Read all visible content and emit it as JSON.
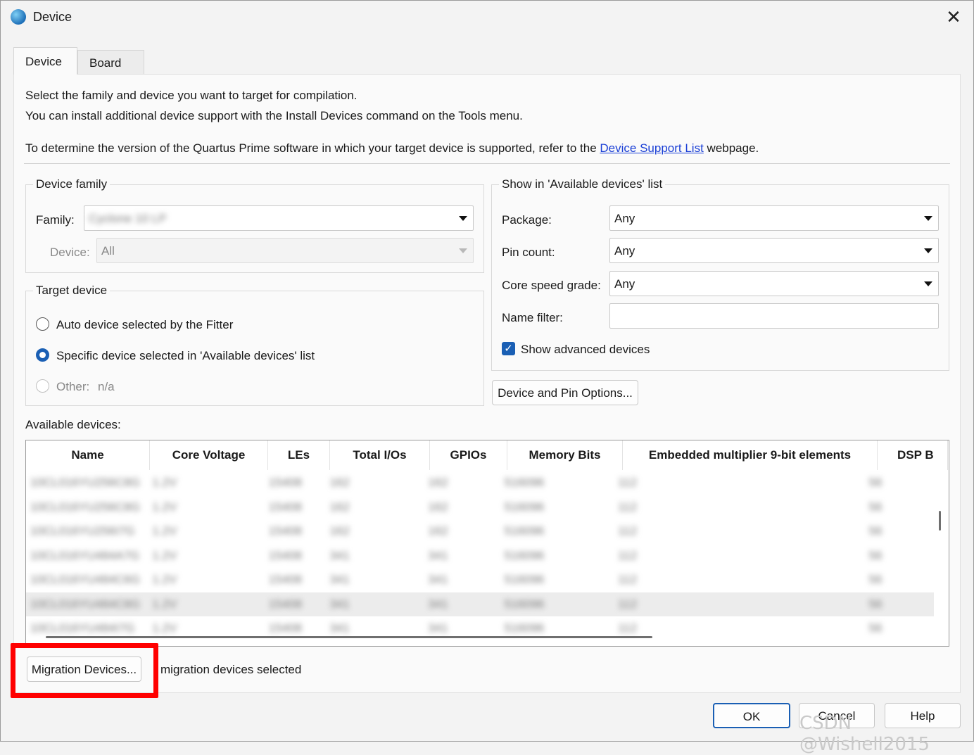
{
  "window": {
    "title": "Device",
    "close_glyph": "✕"
  },
  "tabs": [
    {
      "label": "Device"
    },
    {
      "label": "Board"
    }
  ],
  "intro": {
    "line1": "Select the family and device you want to target for compilation.",
    "line2": "You can install additional device support with the Install Devices command on the Tools menu.",
    "line3_prefix": "To determine the version of the Quartus Prime software in which your target device is supported, refer to the ",
    "line3_link": "Device Support List",
    "line3_suffix": " webpage."
  },
  "device_family": {
    "title": "Device family",
    "family_label": "Family:",
    "family_value": "Cyclone 10 LP",
    "device_label": "Device:",
    "device_value": "All"
  },
  "target_device": {
    "title": "Target device",
    "options": [
      {
        "label": "Auto device selected by the Fitter",
        "checked": false,
        "enabled": true
      },
      {
        "label": "Specific device selected in 'Available devices' list",
        "checked": true,
        "enabled": true
      },
      {
        "label": "Other:",
        "value": "n/a",
        "checked": false,
        "enabled": false
      }
    ]
  },
  "filters": {
    "title": "Show in 'Available devices' list",
    "package_label": "Package:",
    "package_value": "Any",
    "pin_count_label": "Pin count:",
    "pin_count_value": "Any",
    "speed_label": "Core speed grade:",
    "speed_value": "Any",
    "name_filter_label": "Name filter:",
    "name_filter_value": "",
    "advanced_label": "Show advanced devices",
    "advanced_checked": true
  },
  "device_pin_options_label": "Device and Pin Options...",
  "available_devices": {
    "label": "Available devices:",
    "columns": [
      "Name",
      "Core Voltage",
      "LEs",
      "Total I/Os",
      "GPIOs",
      "Memory Bits",
      "Embedded multiplier 9-bit elements",
      "DSP B"
    ],
    "rows": [
      [
        "10CL016YU256C8G",
        "1.2V",
        "15408",
        "162",
        "162",
        "516096",
        "112",
        "56"
      ],
      [
        "10CL016YU256C8G",
        "1.2V",
        "15408",
        "162",
        "162",
        "516096",
        "112",
        "56"
      ],
      [
        "10CL016YU256I7G",
        "1.2V",
        "15408",
        "162",
        "162",
        "516096",
        "112",
        "56"
      ],
      [
        "10CL016YU484A7G",
        "1.2V",
        "15408",
        "341",
        "341",
        "516096",
        "112",
        "56"
      ],
      [
        "10CL016YU484C6G",
        "1.2V",
        "15408",
        "341",
        "341",
        "516096",
        "112",
        "56"
      ],
      [
        "10CL016YU484C8G",
        "1.2V",
        "15408",
        "341",
        "341",
        "516096",
        "112",
        "56"
      ],
      [
        "10CL016YU484I7G",
        "1.2V",
        "15408",
        "341",
        "341",
        "516096",
        "112",
        "56"
      ]
    ],
    "selected_row": 5
  },
  "migration": {
    "button_label": "Migration Devices...",
    "status": "migration devices selected"
  },
  "footer": {
    "ok": "OK",
    "cancel": "Cancel",
    "help": "Help"
  },
  "watermark": "CSDN @Wishell2015",
  "colors": {
    "accent": "#1a5fb4",
    "highlight": "#ff0000",
    "link": "#1a3fd6"
  }
}
